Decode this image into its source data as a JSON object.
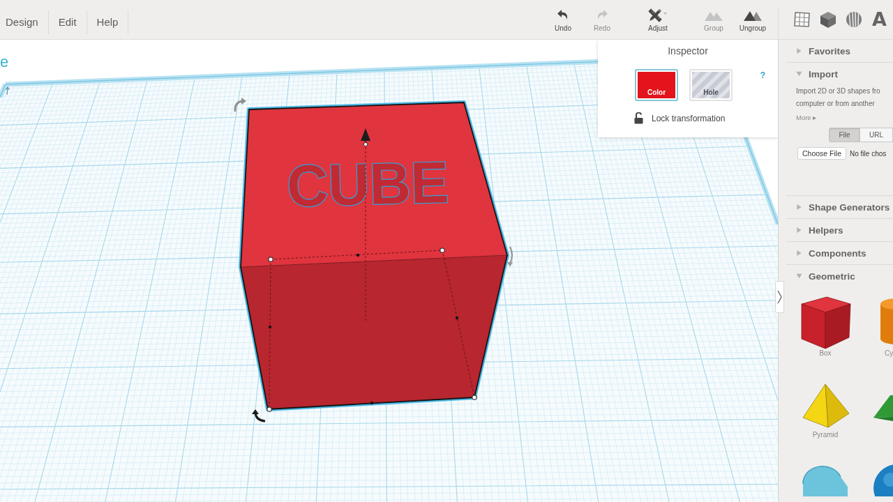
{
  "menu": [
    "Design",
    "Edit",
    "Help"
  ],
  "toolbar": {
    "groups": [
      [
        {
          "label": "Undo",
          "kind": "undo",
          "disabled": false
        },
        {
          "label": "Redo",
          "kind": "redo",
          "disabled": true
        }
      ],
      [
        {
          "label": "Adjust",
          "kind": "adjust",
          "disabled": false
        }
      ],
      [
        {
          "label": "Group",
          "kind": "group",
          "disabled": true
        },
        {
          "label": "Ungroup",
          "kind": "ungroup",
          "disabled": false
        }
      ]
    ]
  },
  "view_buttons": [
    {
      "kind": "grid"
    },
    {
      "kind": "cube"
    },
    {
      "kind": "striped-ball"
    },
    {
      "kind": "letter",
      "label": "A"
    }
  ],
  "canvas": {
    "design_name": "e",
    "model": {
      "text": "CUBE",
      "selected": true
    }
  },
  "inspector": {
    "title": "Inspector",
    "modes": [
      {
        "label": "Color",
        "kind": "solid",
        "selected": true
      },
      {
        "label": "Hole",
        "kind": "hole",
        "selected": false
      }
    ],
    "help": "?",
    "lock": {
      "label": "Lock transformation",
      "locked": false
    }
  },
  "sidebar": {
    "sections": [
      {
        "title": "Favorites",
        "kind": "plain",
        "expanded": false
      },
      {
        "title": "Import",
        "kind": "import",
        "expanded": true,
        "description": [
          "Import 2D or 3D shapes fro",
          "computer or from another"
        ],
        "more": "More ▸",
        "source_tabs": [
          {
            "label": "File",
            "selected": true
          },
          {
            "label": "URL",
            "selected": false
          }
        ],
        "file_button": "Choose File",
        "file_status": "No file chos"
      },
      {
        "title": "Shape Generators",
        "kind": "plain",
        "expanded": false
      },
      {
        "title": "Helpers",
        "kind": "plain",
        "expanded": false
      },
      {
        "title": "Components",
        "kind": "plain",
        "expanded": false
      },
      {
        "title": "Geometric",
        "kind": "shapes",
        "expanded": true,
        "shapes": [
          {
            "kind": "box",
            "label": "Box"
          },
          {
            "kind": "cylinder",
            "label": "Cy"
          },
          {
            "kind": "pyramid",
            "label": "Pyramid"
          },
          {
            "kind": "roof"
          },
          {
            "kind": "half-cylinder"
          },
          {
            "kind": "sphere"
          }
        ]
      }
    ]
  }
}
